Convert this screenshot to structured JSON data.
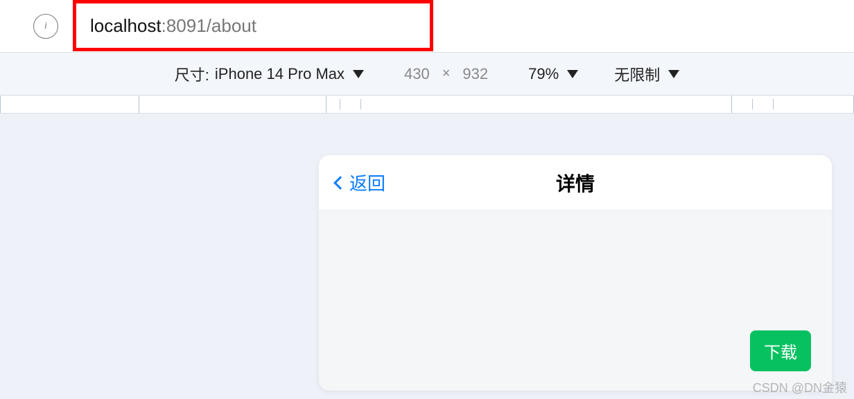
{
  "address_bar": {
    "info_glyph": "i",
    "url_host": "localhost",
    "url_rest": ":8091/about"
  },
  "device_toolbar": {
    "size_label": "尺寸:",
    "device_name": "iPhone 14 Pro Max",
    "width": "430",
    "height": "932",
    "zoom": "79%",
    "throttle": "无限制"
  },
  "app": {
    "back_label": "返回",
    "title": "详情",
    "download_label": "下载"
  },
  "watermark": "CSDN @DN金猿"
}
